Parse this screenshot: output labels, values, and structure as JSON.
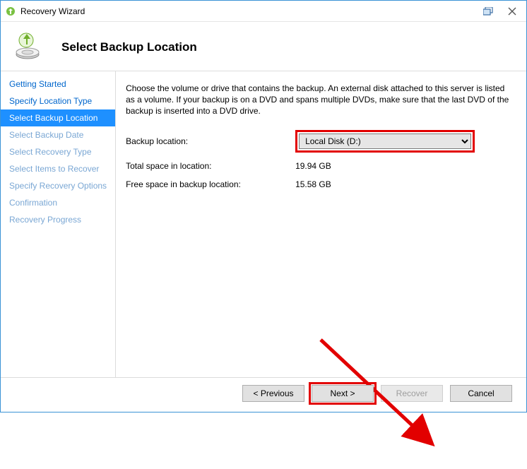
{
  "window": {
    "title": "Recovery Wizard"
  },
  "header": {
    "title": "Select Backup Location"
  },
  "sidebar": {
    "items": [
      {
        "label": "Getting Started",
        "state": "done"
      },
      {
        "label": "Specify Location Type",
        "state": "done"
      },
      {
        "label": "Select Backup Location",
        "state": "active"
      },
      {
        "label": "Select Backup Date",
        "state": "pending"
      },
      {
        "label": "Select Recovery Type",
        "state": "pending"
      },
      {
        "label": "Select Items to Recover",
        "state": "pending"
      },
      {
        "label": "Specify Recovery Options",
        "state": "pending"
      },
      {
        "label": "Confirmation",
        "state": "pending"
      },
      {
        "label": "Recovery Progress",
        "state": "pending"
      }
    ]
  },
  "content": {
    "description": "Choose the volume or drive that contains the backup. An external disk attached to this server is listed as a volume. If your backup is on a DVD and spans multiple DVDs, make sure that the last DVD of the backup is inserted into a DVD drive.",
    "backup_location_label": "Backup location:",
    "backup_location_value": "Local Disk (D:)",
    "total_space_label": "Total space in location:",
    "total_space_value": "19.94 GB",
    "free_space_label": "Free space in backup location:",
    "free_space_value": "15.58 GB"
  },
  "footer": {
    "previous": "< Previous",
    "next": "Next >",
    "recover": "Recover",
    "cancel": "Cancel"
  },
  "annotation": {
    "highlight_select": true,
    "highlight_next": true,
    "arrow": true
  }
}
